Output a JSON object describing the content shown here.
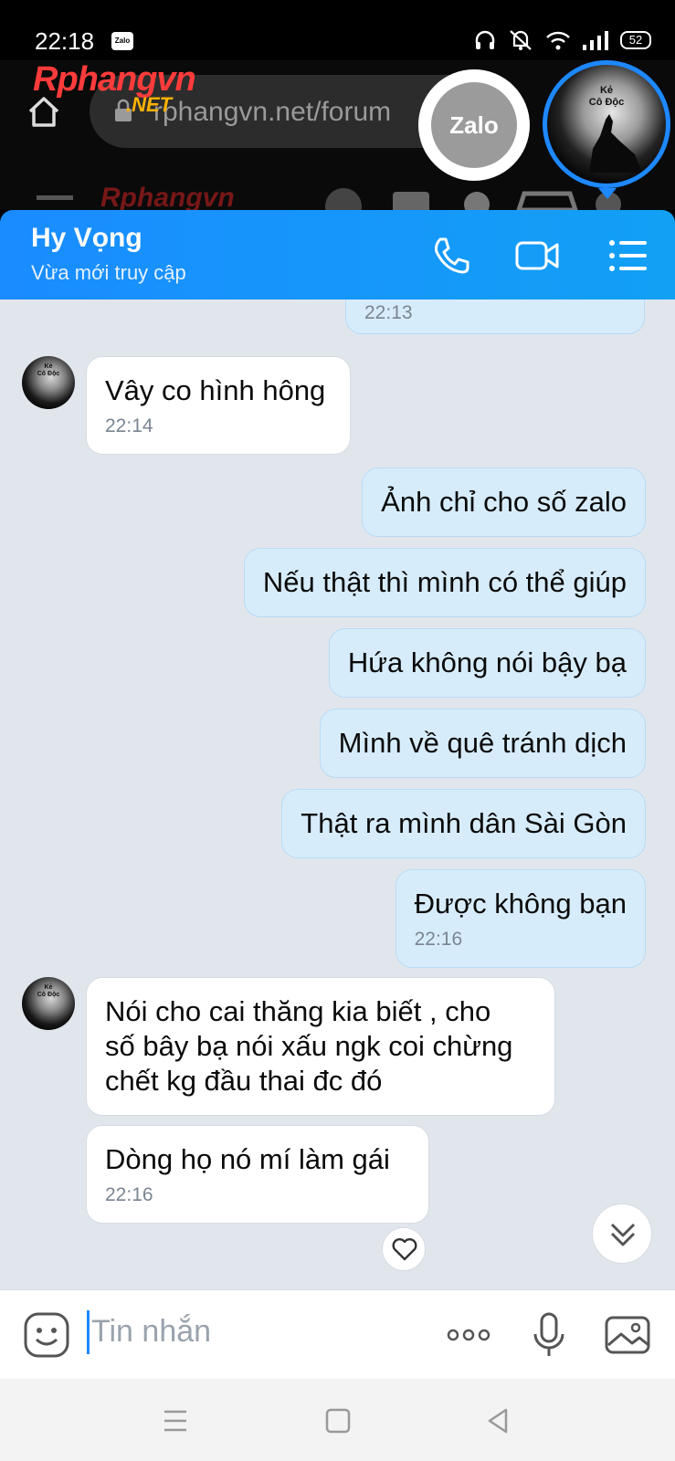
{
  "status_bar": {
    "time": "22:18",
    "notification_badge": "Zalo",
    "battery": "52"
  },
  "browser": {
    "logo_main": "Rphangvn",
    "logo_suffix": ".NET",
    "url": "rphangvn.net/forum",
    "faded_logo": "Rphangvn"
  },
  "floating": {
    "zalo_bubble_label": "Zalo",
    "chat_head_label_line1": "Kẻ",
    "chat_head_label_line2": "Cô Độc"
  },
  "header": {
    "contact_name": "Hy Vọng",
    "contact_status": "Vừa mới truy cập"
  },
  "messages": [
    {
      "side": "out",
      "text": "",
      "time": "22:13"
    },
    {
      "side": "in",
      "text": "Vây co hình hông",
      "time": "22:14",
      "avatar_label_1": "Kẻ",
      "avatar_label_2": "Cô Độc"
    },
    {
      "side": "out",
      "text": "Ảnh chỉ cho số zalo",
      "time": ""
    },
    {
      "side": "out",
      "text": "Nếu thật thì mình có thể giúp",
      "time": ""
    },
    {
      "side": "out",
      "text": "Hứa không nói bậy bạ",
      "time": ""
    },
    {
      "side": "out",
      "text": "Mình về quê tránh dịch",
      "time": ""
    },
    {
      "side": "out",
      "text": "Thật ra mình dân Sài Gòn",
      "time": ""
    },
    {
      "side": "out",
      "text": "Được không bạn",
      "time": "22:16"
    },
    {
      "side": "in",
      "text_line1": "Nói cho cai thăng kia biết , cho",
      "text_line2": "số bây bạ nói xấu ngk coi chừng",
      "text_line3": "chết kg đầu thai đc đó",
      "time": "",
      "avatar_label_1": "Kẻ",
      "avatar_label_2": "Cô Độc"
    },
    {
      "side": "in",
      "text": "Dòng họ nó mí làm gái",
      "time": "22:16"
    }
  ],
  "input": {
    "placeholder": "Tin nhắn"
  },
  "colors": {
    "header_blue": "#1a8cff",
    "outgoing_bubble": "#d7ecfb",
    "incoming_bubble": "#ffffff",
    "chat_background": "#e1e6ed"
  }
}
